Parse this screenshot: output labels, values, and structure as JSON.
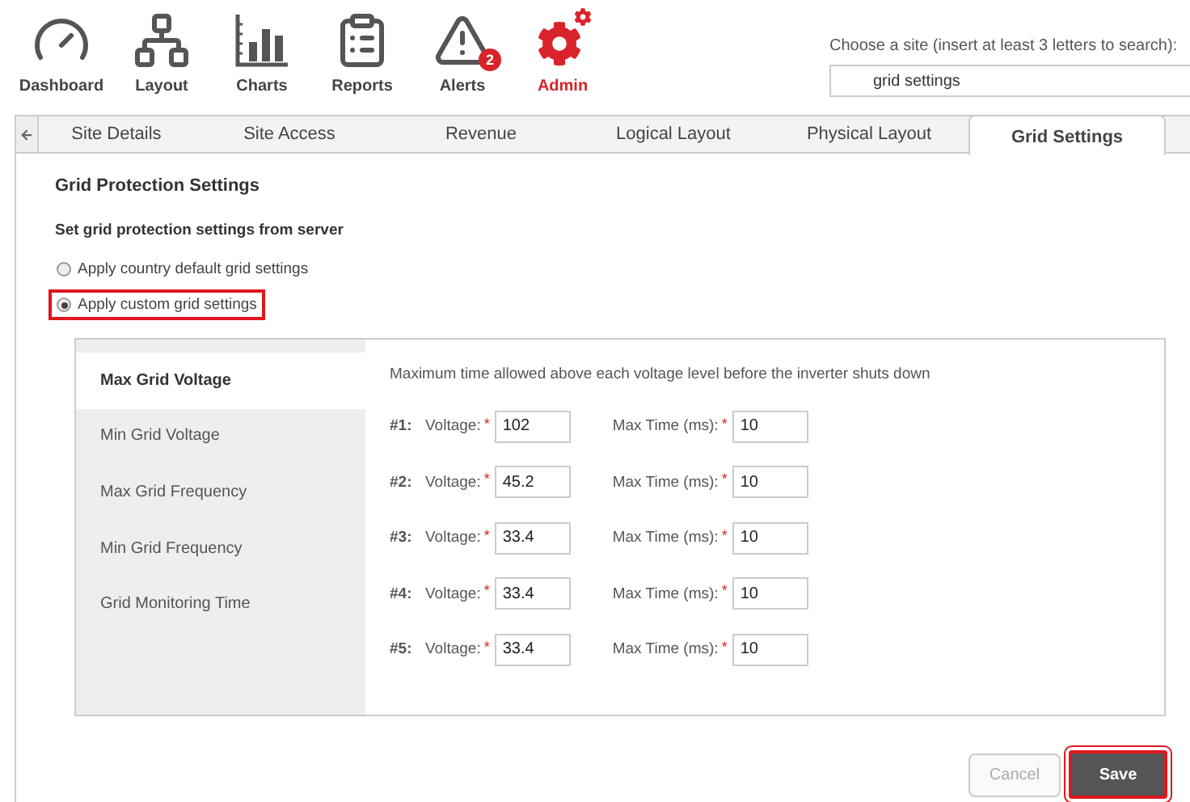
{
  "nav": [
    {
      "label": "Dashboard",
      "selected": false
    },
    {
      "label": "Layout",
      "selected": false
    },
    {
      "label": "Charts",
      "selected": false
    },
    {
      "label": "Reports",
      "selected": false
    },
    {
      "label": "Alerts",
      "selected": false,
      "badge": "2"
    },
    {
      "label": "Admin",
      "selected": true
    }
  ],
  "site_chooser": {
    "label": "Choose a site (insert at least 3 letters to search):",
    "value": "grid settings"
  },
  "tabs": [
    {
      "label": "Site Details",
      "selected": false
    },
    {
      "label": "Site Access",
      "selected": false
    },
    {
      "label": "Revenue",
      "selected": false
    },
    {
      "label": "Logical Layout",
      "selected": false
    },
    {
      "label": "Physical Layout",
      "selected": false
    },
    {
      "label": "Grid Settings",
      "selected": true
    }
  ],
  "section_title": "Grid Protection Settings",
  "subtitle": "Set grid protection settings from server",
  "options": [
    {
      "label": "Apply country default grid settings",
      "selected": false,
      "highlighted": false
    },
    {
      "label": "Apply custom grid settings",
      "selected": true,
      "highlighted": true
    }
  ],
  "side_menu": [
    {
      "label": "Max Grid Voltage",
      "selected": true
    },
    {
      "label": "Min Grid Voltage",
      "selected": false
    },
    {
      "label": "Max Grid Frequency",
      "selected": false
    },
    {
      "label": "Min Grid Frequency",
      "selected": false
    },
    {
      "label": "Grid Monitoring Time",
      "selected": false
    }
  ],
  "description": "Maximum time allowed above each voltage level before the inverter shuts down",
  "levels": [
    {
      "index": "#1:",
      "voltage_label": "Voltage:",
      "voltage": "102",
      "time_label": "Max Time (ms):",
      "time": "10"
    },
    {
      "index": "#2:",
      "voltage_label": "Voltage:",
      "voltage": "45.2",
      "time_label": "Max Time (ms):",
      "time": "10"
    },
    {
      "index": "#3:",
      "voltage_label": "Voltage:",
      "voltage": "33.4",
      "time_label": "Max Time (ms):",
      "time": "10"
    },
    {
      "index": "#4:",
      "voltage_label": "Voltage:",
      "voltage": "33.4",
      "time_label": "Max Time (ms):",
      "time": "10"
    },
    {
      "index": "#5:",
      "voltage_label": "Voltage:",
      "voltage": "33.4",
      "time_label": "Max Time (ms):",
      "time": "10"
    }
  ],
  "required_mark": "*",
  "buttons": [
    {
      "label": "Cancel",
      "kind": "secondary",
      "highlighted": false
    },
    {
      "label": "Save",
      "kind": "primary",
      "highlighted": true
    }
  ]
}
